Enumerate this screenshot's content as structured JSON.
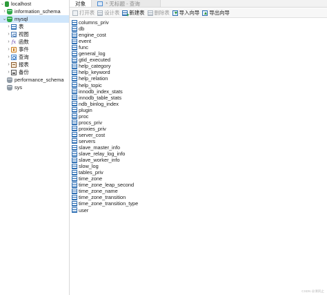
{
  "nav": {
    "connection": "localhost",
    "items": [
      {
        "label": "information_schema",
        "icon": "database-icon",
        "icon_class": "db-green",
        "indent": 0,
        "twisty": "›",
        "selected": false
      },
      {
        "label": "mysql",
        "icon": "database-icon",
        "icon_class": "db-green",
        "indent": 0,
        "twisty": "⌄",
        "selected": true
      },
      {
        "label": "表",
        "icon": "table-icon",
        "icon_class": "tbl",
        "indent": 1,
        "twisty": "›",
        "selected": false
      },
      {
        "label": "视图",
        "icon": "view-icon",
        "icon_class": "view",
        "indent": 1,
        "twisty": "›",
        "selected": false
      },
      {
        "label": "函数",
        "icon": "function-icon",
        "icon_class": "fx",
        "indent": 1,
        "twisty": "›",
        "selected": false
      },
      {
        "label": "事件",
        "icon": "event-icon",
        "icon_class": "evt",
        "indent": 1,
        "twisty": "›",
        "selected": false
      },
      {
        "label": "查询",
        "icon": "query-icon",
        "icon_class": "qry",
        "indent": 1,
        "twisty": "›",
        "selected": false
      },
      {
        "label": "报表",
        "icon": "report-icon",
        "icon_class": "rpt",
        "indent": 1,
        "twisty": "›",
        "selected": false
      },
      {
        "label": "备份",
        "icon": "backup-icon",
        "icon_class": "bak",
        "indent": 1,
        "twisty": "›",
        "selected": false
      },
      {
        "label": "performance_schema",
        "icon": "database-icon",
        "icon_class": "db-grey",
        "indent": 0,
        "twisty": "",
        "selected": false
      },
      {
        "label": "sys",
        "icon": "database-icon",
        "icon_class": "db-grey",
        "indent": 0,
        "twisty": "",
        "selected": false
      }
    ]
  },
  "tabs": {
    "objects": "对象",
    "query": "* 无标题 - 查询"
  },
  "toolbar": {
    "open_table": "打开表",
    "design_table": "设计表",
    "new_table": "新建表",
    "delete_table": "删除表",
    "import_wizard": "导入向导",
    "export_wizard": "导出向导"
  },
  "tables": [
    "columns_priv",
    "db",
    "engine_cost",
    "event",
    "func",
    "general_log",
    "gtid_executed",
    "help_category",
    "help_keyword",
    "help_relation",
    "help_topic",
    "innodb_index_stats",
    "innodb_table_stats",
    "ndb_binlog_index",
    "plugin",
    "proc",
    "procs_priv",
    "proxies_priv",
    "server_cost",
    "servers",
    "slave_master_info",
    "slave_relay_log_info",
    "slave_worker_info",
    "slow_log",
    "tables_priv",
    "time_zone",
    "time_zone_leap_second",
    "time_zone_name",
    "time_zone_transition",
    "time_zone_transition_type",
    "user"
  ],
  "watermark": "CSDN @清风止"
}
